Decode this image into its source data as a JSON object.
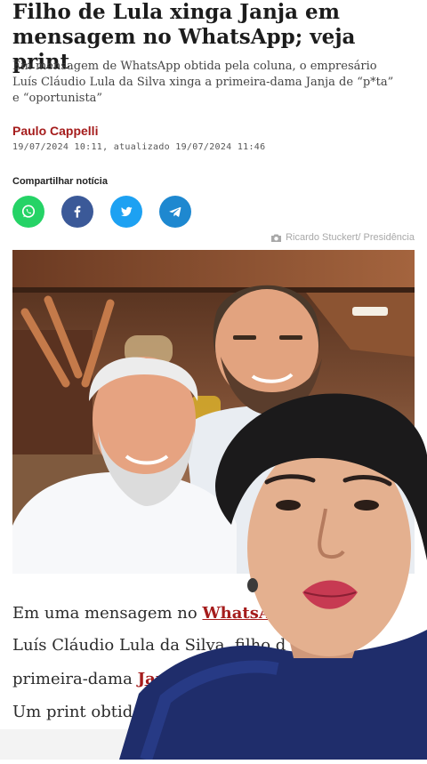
{
  "article": {
    "headline": "Filho de Lula xinga Janja em mensagem no WhatsApp; veja print",
    "subtitle": "Em mensagem de WhatsApp obtida pela coluna, o empresário Luís Cláudio Lula da Silva xinga a primeira-dama Janja de “p*ta” e “oportunista”",
    "author": "Paulo Cappelli",
    "dateline": "19/07/2024 10:11, atualizado 19/07/2024 11:46",
    "share_label": "Compartilhar notícia",
    "share_icons": [
      "whatsapp-icon",
      "facebook-icon",
      "twitter-icon",
      "telegram-icon"
    ],
    "photo_credit": "Ricardo Stuckert/ Presidência",
    "body": {
      "line1_text": "Em uma mensagem no ",
      "line1_link": "WhatsAp",
      "line2_text": "Luís Cláudio Lula da Silva, filho d",
      "line3_text": "primeira-dama ",
      "line3_link": "Jan",
      "line4_text": "Um print obtido"
    }
  },
  "colors": {
    "accent_red": "#a51c1c",
    "whatsapp": "#25d366",
    "facebook": "#3b5998",
    "twitter": "#1da1f2",
    "telegram": "#1e88d0"
  }
}
